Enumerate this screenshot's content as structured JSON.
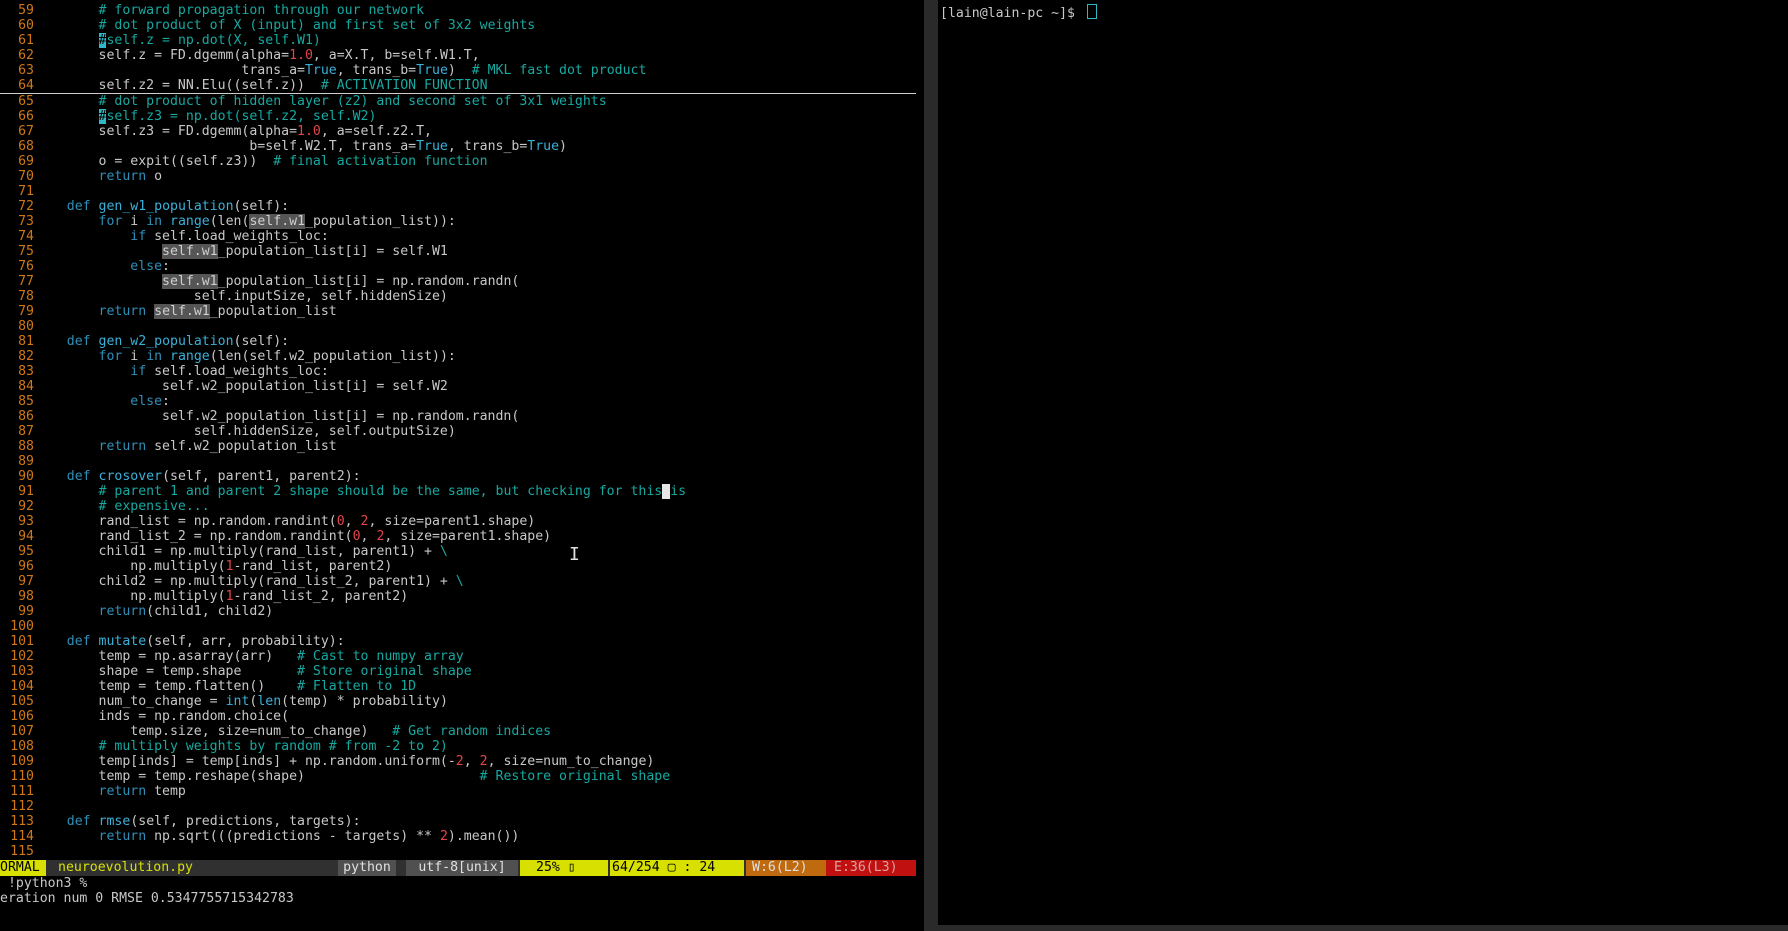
{
  "editor": {
    "lines": [
      {
        "n": "59",
        "segs": [
          [
            "        ",
            ""
          ],
          [
            "# forward propagation through our network",
            "cm"
          ]
        ]
      },
      {
        "n": "60",
        "segs": [
          [
            "        ",
            ""
          ],
          [
            "# dot product of X (input) and first set of 3x2 weights",
            "cm"
          ]
        ]
      },
      {
        "n": "61",
        "segs": [
          [
            "        ",
            ""
          ],
          [
            "#",
            "cursor-cyan"
          ],
          [
            "self.z = np.dot(X, self.W1)",
            "cm"
          ]
        ]
      },
      {
        "n": "62",
        "segs": [
          [
            "        self.z = FD.dgemm(alpha=",
            ""
          ],
          [
            "1.0",
            "num"
          ],
          [
            ", a=X.T, b=self.W1.T,",
            ""
          ]
        ]
      },
      {
        "n": "63",
        "segs": [
          [
            "                          trans_a=",
            ""
          ],
          [
            "True",
            "bool"
          ],
          [
            ", trans_b=",
            ""
          ],
          [
            "True",
            "bool"
          ],
          [
            ")  ",
            ""
          ],
          [
            "# MKL fast dot product",
            "cm"
          ]
        ]
      },
      {
        "n": "64",
        "segs": [
          [
            "        self.z2 = NN.Elu((self.z))  ",
            ""
          ],
          [
            "# ACTIVATION FUNCTION",
            "cm"
          ]
        ],
        "rule": true
      },
      {
        "n": "65",
        "segs": [
          [
            "        ",
            ""
          ],
          [
            "# dot product of hidden layer (z2) and second set of 3x1 weights",
            "cm"
          ]
        ]
      },
      {
        "n": "66",
        "segs": [
          [
            "        ",
            ""
          ],
          [
            "#",
            "cursor-cyan"
          ],
          [
            "self.z3 = np.dot(self.z2, self.W2)",
            "cm"
          ]
        ]
      },
      {
        "n": "67",
        "segs": [
          [
            "        self.z3 = FD.dgemm(alpha=",
            ""
          ],
          [
            "1.0",
            "num"
          ],
          [
            ", a=self.z2.T,",
            ""
          ]
        ]
      },
      {
        "n": "68",
        "segs": [
          [
            "                           b=self.W2.T, trans_a=",
            ""
          ],
          [
            "True",
            "bool"
          ],
          [
            ", trans_b=",
            ""
          ],
          [
            "True",
            "bool"
          ],
          [
            ")",
            ""
          ]
        ]
      },
      {
        "n": "69",
        "segs": [
          [
            "        o = expit((self.z3))  ",
            ""
          ],
          [
            "# final activation function",
            "cm"
          ]
        ]
      },
      {
        "n": "70",
        "segs": [
          [
            "        ",
            ""
          ],
          [
            "return",
            "kw"
          ],
          [
            " o",
            ""
          ]
        ]
      },
      {
        "n": "71",
        "segs": [
          [
            "",
            ""
          ]
        ]
      },
      {
        "n": "72",
        "segs": [
          [
            "    ",
            ""
          ],
          [
            "def",
            "kw"
          ],
          [
            " ",
            ""
          ],
          [
            "gen_w1_population",
            "fn"
          ],
          [
            "(self):",
            ""
          ]
        ]
      },
      {
        "n": "73",
        "segs": [
          [
            "        ",
            ""
          ],
          [
            "for",
            "kw"
          ],
          [
            " i ",
            ""
          ],
          [
            "in",
            "kw"
          ],
          [
            " ",
            ""
          ],
          [
            "range",
            "fn"
          ],
          [
            "(len(",
            ""
          ],
          [
            "self.w1",
            "hl"
          ],
          [
            "_population_list)):",
            ""
          ]
        ]
      },
      {
        "n": "74",
        "segs": [
          [
            "            ",
            ""
          ],
          [
            "if",
            "kw"
          ],
          [
            " self.load_weights_loc:",
            ""
          ]
        ]
      },
      {
        "n": "75",
        "segs": [
          [
            "                ",
            ""
          ],
          [
            "self.w1",
            "hl"
          ],
          [
            "_population_list[i] = self.W1",
            ""
          ]
        ]
      },
      {
        "n": "76",
        "segs": [
          [
            "            ",
            ""
          ],
          [
            "else",
            "kw"
          ],
          [
            ":",
            ""
          ]
        ]
      },
      {
        "n": "77",
        "segs": [
          [
            "                ",
            ""
          ],
          [
            "self.w1",
            "hl"
          ],
          [
            "_population_list[i] = np.random.randn(",
            ""
          ]
        ]
      },
      {
        "n": "78",
        "segs": [
          [
            "                    self.inputSize, self.hiddenSize)",
            ""
          ]
        ]
      },
      {
        "n": "79",
        "segs": [
          [
            "        ",
            ""
          ],
          [
            "return",
            "kw"
          ],
          [
            " ",
            ""
          ],
          [
            "self.w1",
            "hl"
          ],
          [
            "_population_list",
            ""
          ]
        ]
      },
      {
        "n": "80",
        "segs": [
          [
            "",
            ""
          ]
        ]
      },
      {
        "n": "81",
        "segs": [
          [
            "    ",
            ""
          ],
          [
            "def",
            "kw"
          ],
          [
            " ",
            ""
          ],
          [
            "gen_w2_population",
            "fn"
          ],
          [
            "(self):",
            ""
          ]
        ]
      },
      {
        "n": "82",
        "segs": [
          [
            "        ",
            ""
          ],
          [
            "for",
            "kw"
          ],
          [
            " i ",
            ""
          ],
          [
            "in",
            "kw"
          ],
          [
            " ",
            ""
          ],
          [
            "range",
            "fn"
          ],
          [
            "(len(self.w2_population_list)):",
            ""
          ]
        ]
      },
      {
        "n": "83",
        "segs": [
          [
            "            ",
            ""
          ],
          [
            "if",
            "kw"
          ],
          [
            " self.load_weights_loc:",
            ""
          ]
        ]
      },
      {
        "n": "84",
        "segs": [
          [
            "                self.w2_population_list[i] = self.W2",
            ""
          ]
        ]
      },
      {
        "n": "85",
        "segs": [
          [
            "            ",
            ""
          ],
          [
            "else",
            "kw"
          ],
          [
            ":",
            ""
          ]
        ]
      },
      {
        "n": "86",
        "segs": [
          [
            "                self.w2_population_list[i] = np.random.randn(",
            ""
          ]
        ]
      },
      {
        "n": "87",
        "segs": [
          [
            "                    self.hiddenSize, self.outputSize)",
            ""
          ]
        ]
      },
      {
        "n": "88",
        "segs": [
          [
            "        ",
            ""
          ],
          [
            "return",
            "kw"
          ],
          [
            " self.w2_population_list",
            ""
          ]
        ]
      },
      {
        "n": "89",
        "segs": [
          [
            "",
            ""
          ]
        ]
      },
      {
        "n": "90",
        "segs": [
          [
            "    ",
            ""
          ],
          [
            "def",
            "kw"
          ],
          [
            " ",
            ""
          ],
          [
            "crosover",
            "fn"
          ],
          [
            "(self, parent1, parent2):",
            ""
          ]
        ]
      },
      {
        "n": "91",
        "segs": [
          [
            "        ",
            ""
          ],
          [
            "# parent 1 and parent 2 shape should be the same, but checking for this",
            "cm"
          ],
          [
            " ",
            "curblk"
          ],
          [
            "is",
            "cm"
          ]
        ]
      },
      {
        "n": "92",
        "segs": [
          [
            "        ",
            ""
          ],
          [
            "# expensive...",
            "cm"
          ]
        ]
      },
      {
        "n": "93",
        "segs": [
          [
            "        rand_list = np.random.randint(",
            ""
          ],
          [
            "0",
            "num"
          ],
          [
            ", ",
            ""
          ],
          [
            "2",
            "num"
          ],
          [
            ", size=parent1.shape)",
            ""
          ]
        ]
      },
      {
        "n": "94",
        "segs": [
          [
            "        rand_list_2 = np.random.randint(",
            ""
          ],
          [
            "0",
            "num"
          ],
          [
            ", ",
            ""
          ],
          [
            "2",
            "num"
          ],
          [
            ", size=parent1.shape)",
            ""
          ]
        ]
      },
      {
        "n": "95",
        "segs": [
          [
            "        child1 = np.multiply(rand_list, parent1) + ",
            ""
          ],
          [
            "\\",
            "cm"
          ]
        ]
      },
      {
        "n": "96",
        "segs": [
          [
            "            np.multiply(",
            ""
          ],
          [
            "1",
            "num"
          ],
          [
            "-rand_list, parent2)",
            ""
          ]
        ]
      },
      {
        "n": "97",
        "segs": [
          [
            "        child2 = np.multiply(rand_list_2, parent1) + ",
            ""
          ],
          [
            "\\",
            "cm"
          ]
        ]
      },
      {
        "n": "98",
        "segs": [
          [
            "            np.multiply(",
            ""
          ],
          [
            "1",
            "num"
          ],
          [
            "-rand_list_2, parent2)",
            ""
          ]
        ]
      },
      {
        "n": "99",
        "segs": [
          [
            "        ",
            ""
          ],
          [
            "return",
            "kw"
          ],
          [
            "(child1, child2)",
            ""
          ]
        ]
      },
      {
        "n": "100",
        "segs": [
          [
            "",
            ""
          ]
        ]
      },
      {
        "n": "101",
        "segs": [
          [
            "    ",
            ""
          ],
          [
            "def",
            "kw"
          ],
          [
            " ",
            ""
          ],
          [
            "mutate",
            "fn"
          ],
          [
            "(self, arr, probability):",
            ""
          ]
        ]
      },
      {
        "n": "102",
        "segs": [
          [
            "        temp = np.asarray(arr)   ",
            ""
          ],
          [
            "# Cast to numpy array",
            "cm"
          ]
        ]
      },
      {
        "n": "103",
        "segs": [
          [
            "        shape = temp.shape       ",
            ""
          ],
          [
            "# Store original shape",
            "cm"
          ]
        ]
      },
      {
        "n": "104",
        "segs": [
          [
            "        temp = temp.flatten()    ",
            ""
          ],
          [
            "# Flatten to 1D",
            "cm"
          ]
        ]
      },
      {
        "n": "105",
        "segs": [
          [
            "        num_to_change = ",
            ""
          ],
          [
            "int",
            "fn"
          ],
          [
            "(",
            ""
          ],
          [
            "len",
            "fn"
          ],
          [
            "(temp) * probability)",
            ""
          ]
        ]
      },
      {
        "n": "106",
        "segs": [
          [
            "        inds = np.random.choice(",
            ""
          ]
        ]
      },
      {
        "n": "107",
        "segs": [
          [
            "            temp.size, size=num_to_change)   ",
            ""
          ],
          [
            "# Get random indices",
            "cm"
          ]
        ]
      },
      {
        "n": "108",
        "segs": [
          [
            "        ",
            ""
          ],
          [
            "# multiply weights by random # from -2 to 2)",
            "cm"
          ]
        ]
      },
      {
        "n": "109",
        "segs": [
          [
            "        temp[inds] = temp[inds] + np.random.uniform(-",
            ""
          ],
          [
            "2",
            "num"
          ],
          [
            ", ",
            ""
          ],
          [
            "2",
            "num"
          ],
          [
            ", size=num_to_change)",
            ""
          ]
        ]
      },
      {
        "n": "110",
        "segs": [
          [
            "        temp = temp.reshape(shape)                      ",
            ""
          ],
          [
            "# Restore original shape",
            "cm"
          ]
        ]
      },
      {
        "n": "111",
        "segs": [
          [
            "        ",
            ""
          ],
          [
            "return",
            "kw"
          ],
          [
            " temp",
            ""
          ]
        ]
      },
      {
        "n": "112",
        "segs": [
          [
            "",
            ""
          ]
        ]
      },
      {
        "n": "113",
        "segs": [
          [
            "    ",
            ""
          ],
          [
            "def",
            "kw"
          ],
          [
            " ",
            ""
          ],
          [
            "rmse",
            "fn"
          ],
          [
            "(self, predictions, targets):",
            ""
          ]
        ]
      },
      {
        "n": "114",
        "segs": [
          [
            "        ",
            ""
          ],
          [
            "return",
            "kw"
          ],
          [
            " np.sqrt(((predictions - targets) ** ",
            ""
          ],
          [
            "2",
            "num"
          ],
          [
            ").mean())",
            ""
          ]
        ]
      },
      {
        "n": "115",
        "segs": [
          [
            "",
            ""
          ]
        ]
      }
    ]
  },
  "statusline": {
    "mode": "ORMAL",
    "filename": "neuroevolution.py",
    "filetype": "python",
    "encoding": "utf-8[unix]",
    "percent": "25% ▯",
    "position": "64/254 ▢ : 24",
    "warnings": "W:6(L2)",
    "errors": "E:36(L3)"
  },
  "cmdline": " !python3 %",
  "output": "eration num 0 RMSE 0.5347755715342783",
  "terminal": {
    "prompt": "[lain@lain-pc ~]$ "
  },
  "scroll": {
    "fraction_top": 0.22,
    "fraction_visible": 0.23
  },
  "colors": {
    "accent_yellow": "#d7e000",
    "comment_cyan": "#17a8a0",
    "keyword_blue": "#2f8fb8",
    "number_red": "#e0454a",
    "line_number_orange": "#d07818"
  }
}
